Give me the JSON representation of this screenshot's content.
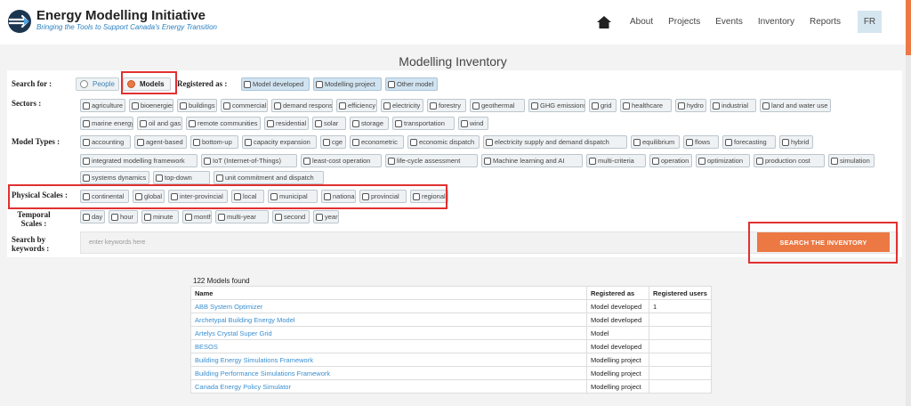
{
  "header": {
    "title": "Energy Modelling Initiative",
    "tagline": "Bringing the Tools to Support Canada's Energy Transition",
    "nav": [
      "About",
      "Projects",
      "Events",
      "Inventory",
      "Reports"
    ],
    "lang": "FR",
    "home_icon": "home-icon"
  },
  "page_title": "Modelling Inventory",
  "search": {
    "search_for_label": "Search for :",
    "people_label": "People",
    "models_label": "Models",
    "selected": "Models",
    "registered_as_label": "Registered as :",
    "registered_options": [
      "Model developed",
      "Modelling project",
      "Other model"
    ],
    "sectors_label": "Sectors :",
    "sectors": [
      "agriculture",
      "bioenergies",
      "buildings",
      "commercial",
      "demand response",
      "efficiency",
      "electricity",
      "forestry",
      "geothermal",
      "GHG emissions",
      "grid",
      "healthcare",
      "hydro",
      "industrial",
      "land and water use",
      "marine energy",
      "oil and gas",
      "remote communities",
      "residential",
      "solar",
      "storage",
      "transportation",
      "wind"
    ],
    "model_types_label": "Model Types :",
    "model_types": [
      "accounting",
      "agent-based",
      "bottom-up",
      "capacity expansion",
      "cge",
      "econometric",
      "economic dispatch",
      "electricity supply and demand dispatch",
      "equilibrium",
      "flows",
      "forecasting",
      "hybrid",
      "integrated modelling framework",
      "IoT (Internet-of-Things)",
      "least-cost operation",
      "life-cycle assessment",
      "Machine learning and AI",
      "multi-criteria",
      "operation",
      "optimization",
      "production cost",
      "simulation",
      "systems dynamics",
      "top-down",
      "unit commitment and dispatch"
    ],
    "physical_scales_label": "Physical Scales :",
    "physical_scales": [
      "continental",
      "global",
      "inter-provincial",
      "local",
      "municipal",
      "national",
      "provincial",
      "regional"
    ],
    "temporal_scales_label": "Temporal Scales :",
    "temporal_scales": [
      "day",
      "hour",
      "minute",
      "month",
      "multi-year",
      "second",
      "year"
    ],
    "keywords_label": "Search by keywords :",
    "keywords_placeholder": "enter keywords here",
    "button_label": "SEARCH THE INVENTORY"
  },
  "results": {
    "count_text": "122 Models found",
    "columns": [
      "Name",
      "Registered as",
      "Registered users"
    ],
    "rows": [
      {
        "name": "ABB System Optimizer",
        "registered_as": "Model developed",
        "users": "1"
      },
      {
        "name": "Archetypal Building Energy Model",
        "registered_as": "Model developed",
        "users": ""
      },
      {
        "name": "Artelys Crystal Super Grid",
        "registered_as": "Model",
        "users": ""
      },
      {
        "name": "BESOS",
        "registered_as": "Model developed",
        "users": ""
      },
      {
        "name": "Building Energy Simulations Framework",
        "registered_as": "Modelling project",
        "users": ""
      },
      {
        "name": "Building Performance Simulations Framework",
        "registered_as": "Modelling project",
        "users": ""
      },
      {
        "name": "Canada Energy Policy Simulator",
        "registered_as": "Modelling project",
        "users": ""
      }
    ]
  },
  "colors": {
    "accent": "#ec7843",
    "link": "#3a8fd0",
    "highlight": "#e23030",
    "brand_dark": "#1d3650"
  }
}
